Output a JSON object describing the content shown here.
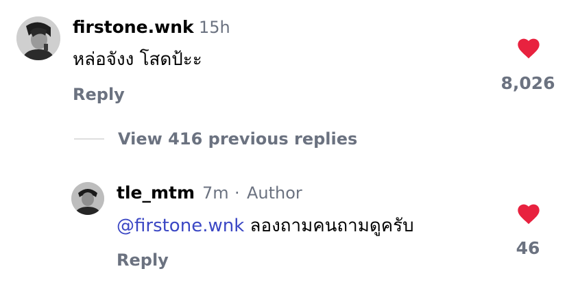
{
  "comment": {
    "username": "firstone.wnk",
    "time": "15h",
    "text": "หล่อจังง โสดป้ะะ",
    "reply_label": "Reply",
    "like_count": "8,026",
    "heart_color": "#e8223f"
  },
  "view_replies": {
    "label": "View 416 previous replies"
  },
  "reply": {
    "username": "tle_mtm",
    "time": "7m",
    "separator": "·",
    "role": "Author",
    "mention": "@firstone.wnk",
    "text": "ลองถามคนถามดูครับ",
    "reply_label": "Reply",
    "like_count": "46"
  },
  "icons": {
    "avatar_1": "user-avatar-icon",
    "avatar_2": "user-avatar-icon",
    "like": "heart-icon"
  },
  "colors": {
    "secondary_text": "#6b7280",
    "mention": "#3b47c4",
    "heart": "#e8223f"
  }
}
